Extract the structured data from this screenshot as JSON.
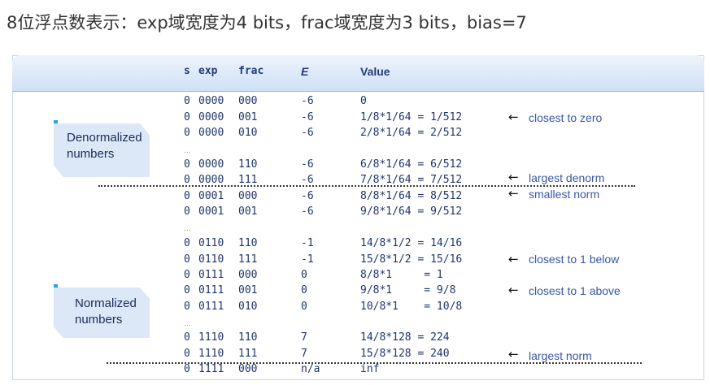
{
  "title": "8位浮点数表示：exp域宽度为4 bits，frac域宽度为3 bits，bias=7",
  "headers": {
    "s": "s",
    "exp": "exp",
    "frac": "frac",
    "E": "E",
    "value": "Value"
  },
  "rows": [
    {
      "s": "0",
      "exp": "0000",
      "frac": "000",
      "E": "-6",
      "value": "0"
    },
    {
      "s": "0",
      "exp": "0000",
      "frac": "001",
      "E": "-6",
      "value": "1/8*1/64 = 1/512"
    },
    {
      "s": "0",
      "exp": "0000",
      "frac": "010",
      "E": "-6",
      "value": "2/8*1/64 = 2/512"
    },
    {
      "s": "0",
      "exp": "0000",
      "frac": "110",
      "E": "-6",
      "value": "6/8*1/64 = 6/512"
    },
    {
      "s": "0",
      "exp": "0000",
      "frac": "111",
      "E": "-6",
      "value": "7/8*1/64 = 7/512"
    },
    {
      "s": "0",
      "exp": "0001",
      "frac": "000",
      "E": "-6",
      "value": "8/8*1/64 = 8/512"
    },
    {
      "s": "0",
      "exp": "0001",
      "frac": "001",
      "E": "-6",
      "value": "9/8*1/64 = 9/512"
    },
    {
      "s": "0",
      "exp": "0110",
      "frac": "110",
      "E": "-1",
      "value": "14/8*1/2 = 14/16"
    },
    {
      "s": "0",
      "exp": "0110",
      "frac": "111",
      "E": "-1",
      "value": "15/8*1/2 = 15/16"
    },
    {
      "s": "0",
      "exp": "0111",
      "frac": "000",
      "E": "0",
      "value": "8/8*1     = 1"
    },
    {
      "s": "0",
      "exp": "0111",
      "frac": "001",
      "E": "0",
      "value": "9/8*1     = 9/8"
    },
    {
      "s": "0",
      "exp": "0111",
      "frac": "010",
      "E": "0",
      "value": "10/8*1    = 10/8"
    },
    {
      "s": "0",
      "exp": "1110",
      "frac": "110",
      "E": "7",
      "value": "14/8*128 = 224"
    },
    {
      "s": "0",
      "exp": "1110",
      "frac": "111",
      "E": "7",
      "value": "15/8*128 = 240"
    },
    {
      "s": "0",
      "exp": "1111",
      "frac": "000",
      "E": "n/a",
      "value": "inf"
    }
  ],
  "ellipsis": "…",
  "annotations": {
    "closest_to_zero": "closest to zero",
    "largest_denorm": "largest denorm",
    "smallest_norm": "smallest norm",
    "closest_below_1": "closest to 1 below",
    "closest_above_1": "closest to 1 above",
    "largest_norm": "largest norm",
    "arrow": "←"
  },
  "groups": {
    "denormalized": "Denormalized numbers",
    "normalized": "Normalized numbers"
  },
  "colors": {
    "header_band": "#cfe0f6",
    "table_text": "#1f356e",
    "annotation_text": "#3a56a8",
    "badge_bg": "#dce8f8",
    "badge_marker": "#2aa0dc"
  }
}
